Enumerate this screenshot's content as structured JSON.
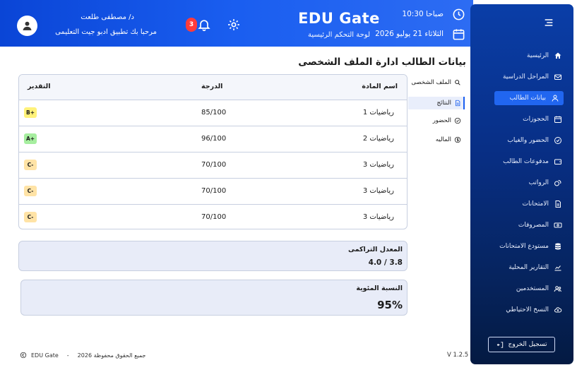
{
  "header": {
    "title": "EDU Gate",
    "subtitle": "لوحة التحكم الرئيسية",
    "time": "10:30 صباحا",
    "date": "الثلاثاء 21 يوليو 2026",
    "notification_count": "3",
    "user_name": "د/ مصطفى طلعت",
    "welcome": "مرحبا بك تطبيق ادبو جيت التعليمى"
  },
  "sidebar": {
    "items": [
      {
        "label": "الرئيسية",
        "icon": "home-icon"
      },
      {
        "label": "المراحل الدراسية",
        "icon": "envelope-icon"
      },
      {
        "label": "بيانات الطالب",
        "icon": "user-icon"
      },
      {
        "label": "الحجوزات",
        "icon": "calendar-icon"
      },
      {
        "label": "الحضور والغياب",
        "icon": "check-circle-icon"
      },
      {
        "label": "مدفوعات الطالب",
        "icon": "wallet-icon"
      },
      {
        "label": "الرواتب",
        "icon": "coins-icon"
      },
      {
        "label": "الامتحانات",
        "icon": "document-icon"
      },
      {
        "label": "المصروفات",
        "icon": "cash-icon"
      },
      {
        "label": "مستودع الامتحانات",
        "icon": "database-icon"
      },
      {
        "label": "التقارير المحلية",
        "icon": "chart-icon"
      },
      {
        "label": "المستخدمين",
        "icon": "users-icon"
      },
      {
        "label": "النسخ الاحتياطي",
        "icon": "cloud-icon"
      }
    ],
    "active_index": 2,
    "logout": "تسجيل الخروج"
  },
  "main": {
    "title": "بيانات الطالب ادارة الملف الشخصى",
    "subnav": [
      {
        "label": "الملف الشخصى",
        "icon": "search-icon"
      },
      {
        "label": "النتائج",
        "icon": "document-icon"
      },
      {
        "label": "الحضور",
        "icon": "check-circle-icon"
      },
      {
        "label": "الماليه",
        "icon": "dollar-icon"
      }
    ],
    "table": {
      "headers": {
        "subject": "اسم المادة",
        "score": "الدرجة",
        "grade": "التقدير"
      },
      "rows": [
        {
          "subject": "رياضيات 1",
          "score": "85/100",
          "grade": "B+"
        },
        {
          "subject": "رياضيات 2",
          "score": "96/100",
          "grade": "A+"
        },
        {
          "subject": "رياضيات 3",
          "score": "70/100",
          "grade": "C-"
        },
        {
          "subject": "رياضيات 3",
          "score": "70/100",
          "grade": "C-"
        },
        {
          "subject": "رياضيات 3",
          "score": "70/100",
          "grade": "C-"
        }
      ]
    },
    "gpa": {
      "label": "المعدل التراكمى",
      "value": "4.0 / 3.8"
    },
    "percent": {
      "label": "النسبة المئوية",
      "value": "95%"
    }
  },
  "footer": {
    "brand": "EDU Gate",
    "separator": "-",
    "rights": "جميع الحقوق محفوظة 2026",
    "version": "V 1.2.5"
  },
  "colors": {
    "primary": "#1a5ef0",
    "sidebar_top": "#0a3ea8",
    "sidebar_bottom": "#041a42",
    "grade_b": "#fff27a",
    "grade_a": "#a6ee9f",
    "grade_c": "#ffe3a6"
  }
}
